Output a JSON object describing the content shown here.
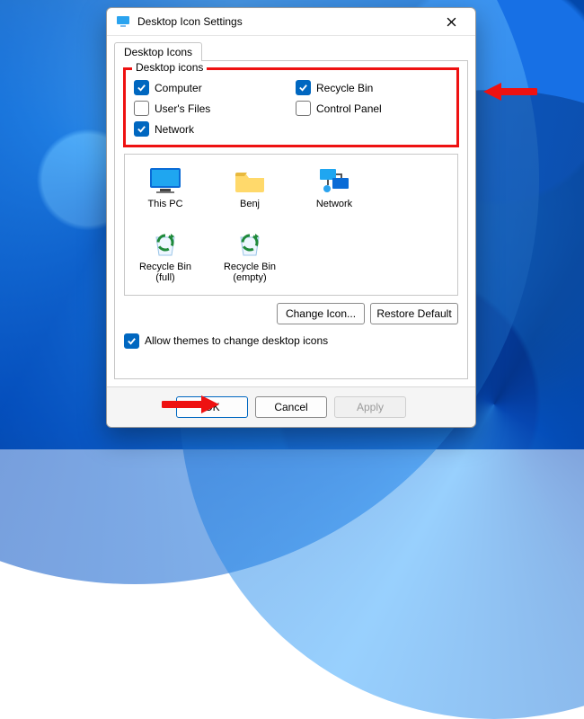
{
  "window": {
    "title": "Desktop Icon Settings"
  },
  "tab": {
    "label": "Desktop Icons"
  },
  "group": {
    "legend": "Desktop icons",
    "items": [
      {
        "label": "Computer",
        "checked": true
      },
      {
        "label": "Recycle Bin",
        "checked": true
      },
      {
        "label": "User's Files",
        "checked": false
      },
      {
        "label": "Control Panel",
        "checked": false
      },
      {
        "label": "Network",
        "checked": true
      }
    ]
  },
  "preview": {
    "items": [
      {
        "label": "This PC",
        "icon": "monitor"
      },
      {
        "label": "Benj",
        "icon": "folder"
      },
      {
        "label": "Network",
        "icon": "network"
      },
      {
        "label": "Recycle Bin (full)",
        "icon": "recycle"
      },
      {
        "label": "Recycle Bin (empty)",
        "icon": "recycle"
      }
    ]
  },
  "buttons": {
    "change": "Change Icon...",
    "restore": "Restore Default",
    "ok": "OK",
    "cancel": "Cancel",
    "apply": "Apply"
  },
  "allow": {
    "label": "Allow themes to change desktop icons",
    "checked": true
  }
}
